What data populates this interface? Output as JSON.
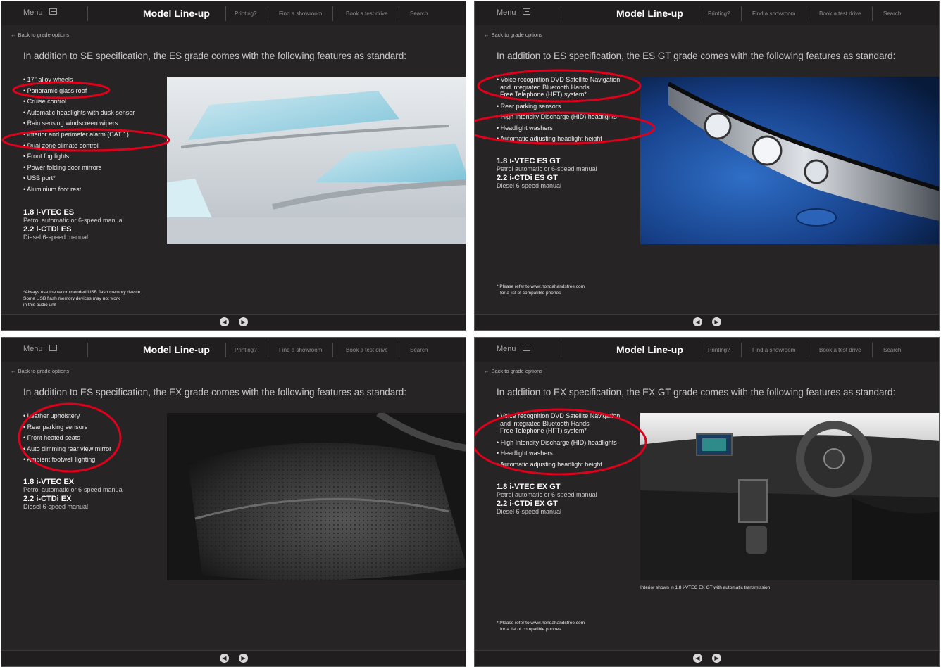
{
  "header": {
    "menu_label": "Menu",
    "title": "Model Line-up",
    "printing": "Printing?",
    "find_showroom": "Find a showroom",
    "test_drive": "Book a test drive",
    "search": "Search"
  },
  "back_link": "Back to grade options",
  "annotation_color": "#e0001b",
  "panels": [
    {
      "intro": "In addition to SE specification, the ES grade comes with the following features as standard:",
      "features": [
        "17\" alloy wheels",
        "Panoramic glass roof",
        "Cruise control",
        "Automatic headlights with dusk sensor",
        "Rain sensing windscreen wipers",
        "Interior and perimeter alarm (CAT 1)",
        "Dual zone climate control",
        "Front fog lights",
        "Power folding door mirrors",
        "USB port*",
        "Aluminium foot rest"
      ],
      "specs": [
        {
          "name": "1.8 i-VTEC ES",
          "desc": "Petrol automatic or 6-speed manual"
        },
        {
          "name": "2.2 i-CTDi ES",
          "desc": "Diesel 6-speed manual"
        }
      ],
      "footnote": [
        "*Always use the recommended USB flash memory device.",
        "Some USB flash memory devices may not work",
        "in this audio unit"
      ],
      "photo": "panoramic-roof-photo"
    },
    {
      "intro": "In addition to ES specification, the ES GT grade comes with the following features as standard:",
      "features": [
        "Voice recognition DVD Satellite Navigation",
        "Rear parking sensors",
        "High Intensity Discharge (HID) headlights",
        "Headlight washers",
        "Automatic adjusting headlight height"
      ],
      "feature_multiline": [
        "Voice recognition DVD Satellite Navigation",
        "and integrated Bluetooth Hands",
        "Free Telephone (HFT) system*"
      ],
      "specs": [
        {
          "name": "1.8 i-VTEC ES GT",
          "desc": "Petrol automatic or 6-speed manual"
        },
        {
          "name": "2.2 i-CTDi ES GT",
          "desc": "Diesel 6-speed manual"
        }
      ],
      "footnote": [
        "* Please refer to www.hondahandsfree.com",
        "for a list of compatible phones"
      ],
      "photo": "headlight-photo"
    },
    {
      "intro": "In addition to ES specification, the EX grade comes with the following features as standard:",
      "features": [
        "Leather upholstery",
        "Rear parking sensors",
        "Front heated seats",
        "Auto dimming rear view mirror",
        "Ambient footwell lighting"
      ],
      "specs": [
        {
          "name": "1.8 i-VTEC EX",
          "desc": "Petrol automatic or 6-speed manual"
        },
        {
          "name": "2.2 i-CTDi EX",
          "desc": "Diesel 6-speed manual"
        }
      ],
      "photo": "leather-seat-photo"
    },
    {
      "intro": "In addition to EX specification, the EX GT grade comes with the following features as standard:",
      "features": [
        "High Intensity Discharge (HID) headlights",
        "Headlight washers",
        "Automatic adjusting headlight height"
      ],
      "feature_multiline": [
        "Voice recognition DVD Satellite Navigation",
        "and integrated Bluetooth Hands",
        "Free Telephone (HFT) system*"
      ],
      "specs": [
        {
          "name": "1.8 i-VTEC EX GT",
          "desc": "Petrol automatic or 6-speed manual"
        },
        {
          "name": "2.2 i-CTDi EX GT",
          "desc": "Diesel 6-speed manual"
        }
      ],
      "caption": "Interior shown in 1.8 i-VTEC EX GT with automatic transmission",
      "footnote": [
        "* Please refer to www.hondahandsfree.com",
        "for a list of compatible phones"
      ],
      "photo": "dashboard-interior-photo"
    }
  ],
  "pager": {
    "prev": "◀",
    "next": "▶"
  }
}
